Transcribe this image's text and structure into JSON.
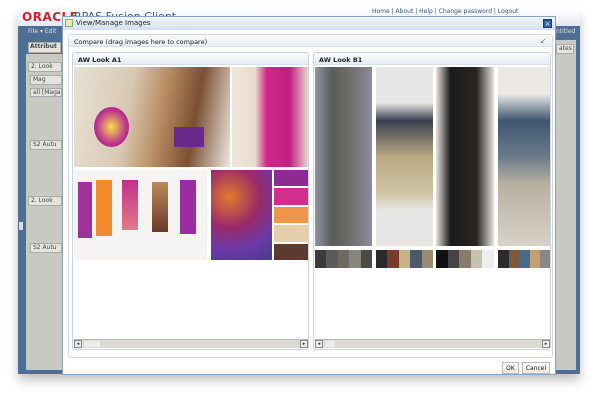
{
  "app": {
    "logo": "ORACLE",
    "title": "RPAS Fusion Client",
    "links": "Home | About | Help | Change password | Logout",
    "menu": "File ▾  Edit",
    "tab": "Attribut",
    "right_tab": "ntitled",
    "right_btn": "ates"
  },
  "side": {
    "items": [
      "2. Look",
      "Mag",
      "all [Magaz",
      "S2 Autu",
      "2. Look",
      "S2 Autu"
    ]
  },
  "dialog": {
    "title": "View/Manage Images",
    "compare_title": "Compare (drag images here to compare)",
    "ok_label": "OK",
    "cancel_label": "Cancel"
  },
  "panels": [
    {
      "title": "AW Look A1",
      "swatches": [
        "#8e2b93",
        "#d12f8c",
        "#f0964a",
        "#e4cfaa",
        "#5c3a2d"
      ]
    },
    {
      "title": "AW Look B1",
      "palettes": [
        [
          "#3a3a3a",
          "#5b5b5b",
          "#6e6a62",
          "#8a857a",
          "#4a4a46"
        ],
        [
          "#2a2a2a",
          "#7a3b2c",
          "#c9b28a",
          "#4a5a6c",
          "#9a8a70"
        ],
        [
          "#111111",
          "#444444",
          "#8a7a6a",
          "#c8c0b0",
          "#eeeeee"
        ],
        [
          "#2b2b2b",
          "#7a5a3a",
          "#4a6a8a",
          "#c8a070",
          "#888888"
        ]
      ]
    }
  ]
}
